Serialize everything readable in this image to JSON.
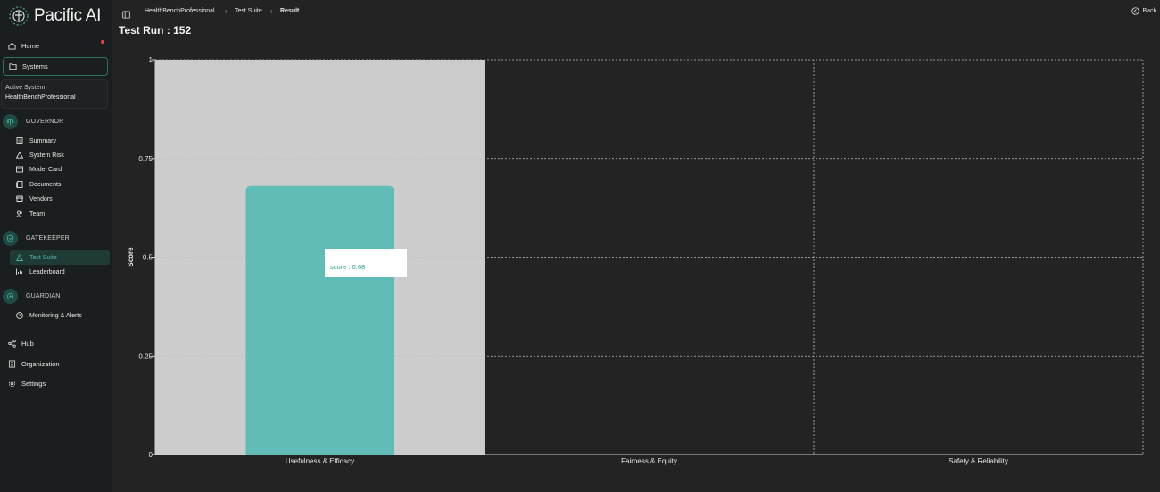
{
  "app": {
    "name": "Pacific AI"
  },
  "sidebar": {
    "home": "Home",
    "systems": "Systems",
    "active_system_label": "Active System:",
    "active_system_value": "HealthBenchProfessional",
    "governor": {
      "title": "GOVERNOR",
      "items": [
        "Summary",
        "System Risk",
        "Model Card",
        "Documents",
        "Vendors",
        "Team"
      ]
    },
    "gatekeeper": {
      "title": "GATEKEEPER",
      "items": [
        "Test Suite",
        "Leaderboard"
      ]
    },
    "guardian": {
      "title": "GUARDIAN",
      "items": [
        "Monitoring & Alerts"
      ]
    },
    "hub": "Hub",
    "organization": "Organization",
    "settings": "Settings"
  },
  "breadcrumb": [
    "HealthBenchProfessional",
    "Test Suite",
    "Result"
  ],
  "back_label": "Back",
  "page_title": "Test Run : 152",
  "colors": {
    "accent": "#5fbcb7",
    "highlight": "#cccccc",
    "background": "#232323"
  },
  "chart_data": {
    "type": "bar",
    "categories": [
      "Usefulness & Efficacy",
      "Fairness & Equity",
      "Safety & Reliability"
    ],
    "series": [
      {
        "name": "score",
        "values": [
          0.68,
          0,
          0
        ]
      }
    ],
    "ylabel": "Score",
    "ylim": [
      0,
      1
    ],
    "yticks": [
      "0",
      "0.25",
      "0.5",
      "0.75",
      "1"
    ],
    "grid": true,
    "highlighted_category": "Usefulness & Efficacy",
    "tooltip": {
      "label": "score : 0.68"
    }
  }
}
